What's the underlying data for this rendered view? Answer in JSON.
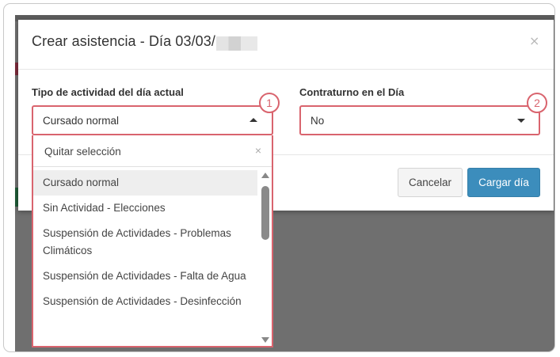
{
  "dialog": {
    "title": "Crear asistencia - Día 03/03/",
    "close_glyph": "×"
  },
  "fields": {
    "activity": {
      "label": "Tipo de actividad del día actual",
      "value": "Cursado normal",
      "badge": "1",
      "expanded": true
    },
    "contraturno": {
      "label": "Contraturno en el Día",
      "value": "No",
      "badge": "2"
    }
  },
  "dropdown": {
    "clear_label": "Quitar selección",
    "clear_glyph": "×",
    "options": [
      "Cursado normal",
      "Sin Actividad - Elecciones",
      "Suspensión de Actividades - Problemas Climáticos",
      "Suspensión de Actividades - Falta de Agua",
      "Suspensión de Actividades - Desinfección"
    ],
    "selected_index": 0
  },
  "buttons": {
    "cancel": "Cancelar",
    "submit": "Cargar día"
  },
  "colors": {
    "highlight": "#d9646e",
    "primary": "#3c8dbc"
  },
  "icons": [
    "close-icon",
    "caret-up-icon",
    "caret-down-icon",
    "clear-selection-icon",
    "scroll-up-icon",
    "scroll-down-icon"
  ]
}
